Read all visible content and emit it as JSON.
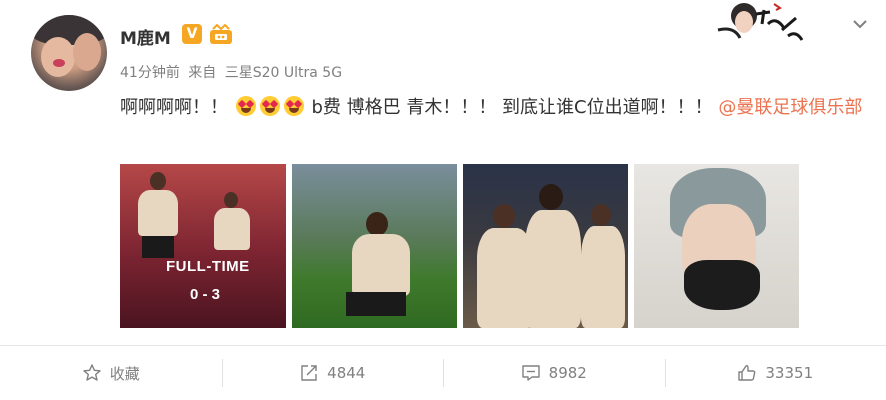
{
  "post": {
    "username": "M鹿M",
    "vip_badge": "V",
    "meta": {
      "time": "41分钟前",
      "source_prefix": "来自",
      "device": "三星S20 Ultra 5G"
    },
    "content": {
      "part1": "啊啊啊啊！！",
      "part2": "b费  博格巴  青木！！！  到底让谁C位出道啊！！！",
      "mention": "@曼联足球俱乐部"
    },
    "emoji_icons": [
      "star-struck-emoji",
      "star-struck-emoji",
      "star-struck-emoji"
    ],
    "images": [
      {
        "name": "full-time-graphic",
        "overlay_title": "FULL-TIME",
        "overlay_score": "0 - 3"
      },
      {
        "name": "player-celebration-knee-slide"
      },
      {
        "name": "team-celebration-hug"
      },
      {
        "name": "selfie-portrait-mask"
      }
    ]
  },
  "actions": {
    "favorite_label": "收藏",
    "repost_count": "4844",
    "comment_count": "8982",
    "like_count": "33351"
  },
  "colors": {
    "mention": "#eb7350",
    "vip": "#f5a623",
    "meta_text": "#808080"
  }
}
